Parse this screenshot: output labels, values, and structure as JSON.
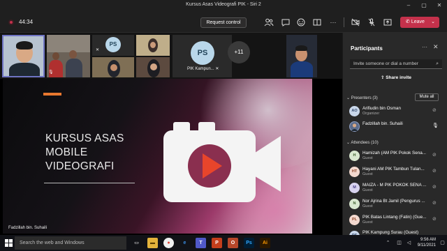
{
  "window": {
    "title": "Kursus Asas Videografi PIK - Siri 2"
  },
  "toolbar": {
    "timer": "44:34",
    "request_control": "Request control",
    "leave": "Leave"
  },
  "strip": {
    "ps_initials": "PS",
    "ps_large_initials": "PS",
    "ps_large_label": "PIK Kampun...",
    "more_count": "+11"
  },
  "slide": {
    "title_lines": [
      "KURSUS ASAS",
      "MOBILE",
      "VIDEOGRAFI"
    ],
    "presenter_label": "Fadzillah bin. Suhaili",
    "accent_color": "#e8782f",
    "play_color": "#e8452b"
  },
  "panel": {
    "title": "Participants",
    "invite_placeholder": "Invite someone or dial a number",
    "share_invite": "Share invite",
    "presenters_header": "Presenters (3)",
    "mute_all": "Mute all",
    "attendees_header": "Attendees (10)",
    "presenters": [
      {
        "initials": "AO",
        "name": "Arifiudin bin Osman",
        "role": "Organizer",
        "avatar_bg": "#c9d7ea",
        "avatar_fg": "#31476b"
      },
      {
        "initials": "",
        "name": "Fadzillah bin. Suhaili",
        "role": "",
        "avatar_bg": "#5b6b8a",
        "avatar_fg": "#ffffff"
      }
    ],
    "attendees": [
      {
        "initials": "H",
        "name": "Hamizah (AM PIK Pokok Sena...",
        "role": "Guest",
        "avatar_bg": "#d9e8d0",
        "avatar_fg": "#3d5f2d"
      },
      {
        "initials": "HT",
        "name": "Hayani AM PIK Tambun Tulan...",
        "role": "Guest",
        "avatar_bg": "#f3d9cf",
        "avatar_fg": "#8a3f22"
      },
      {
        "initials": "M",
        "name": "MAIZA - M PIK POKOK SENA ...",
        "role": "Guest",
        "avatar_bg": "#d8d3ef",
        "avatar_fg": "#473d86"
      },
      {
        "initials": "N",
        "name": "Nor Ajrina Bt Jamil (Pengurus ...",
        "role": "Guest",
        "avatar_bg": "#d9e8d0",
        "avatar_fg": "#3d5f2d"
      },
      {
        "initials": "PL",
        "name": "PIK Batas Lintang (Fatin) (Gue...",
        "role": "Guest",
        "avatar_bg": "#f3d9cf",
        "avatar_fg": "#8a3f22"
      },
      {
        "initials": "PS",
        "name": "PIK Kampung Surau (Guest)",
        "role": "",
        "avatar_bg": "#c9d7ea",
        "avatar_fg": "#31476b"
      }
    ]
  },
  "taskbar": {
    "search_placeholder": "Search the web and Windows",
    "time": "9:56 AM",
    "date": "9/11/2021"
  }
}
